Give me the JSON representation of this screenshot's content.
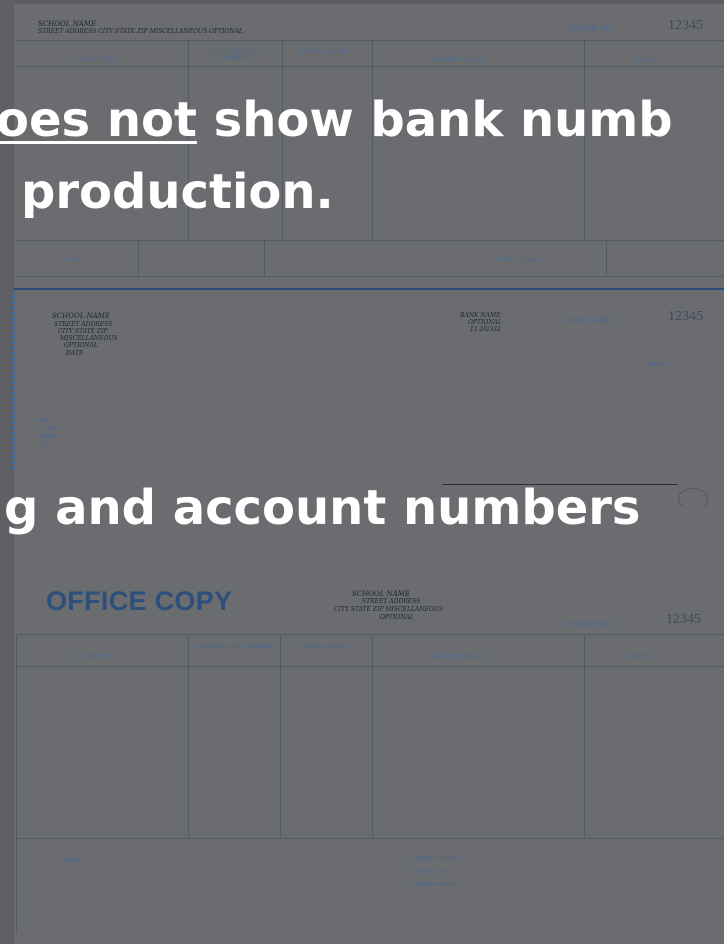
{
  "overlay": {
    "line1_prefix": "oes not",
    "line1_suffix": " show bank numb",
    "line2": "production.",
    "line3": "g and account numbers"
  },
  "stub_top": {
    "school": "SCHOOL NAME",
    "address": "STREET ADDRESS CITY STATE ZIP MISCELLANEOUS OPTIONAL",
    "check_no_label": "CHECK NO.",
    "check_no": "12345",
    "headers": [
      "DESCRIPTION",
      "PURCHASE ORDER NUMBERS",
      "INVOICE NUMBER",
      "ACCOUNT NUMBER",
      "AMOUNT"
    ],
    "date_label": "DATE",
    "check_number_label": "CHECK NUMBER"
  },
  "check": {
    "school": "SCHOOL NAME",
    "address_lines": [
      "STREET ADDRESS",
      "CITY STATE ZIP",
      "MISCELLANEOUS",
      "OPTIONAL"
    ],
    "date_label": "DATE",
    "bank_lines": [
      "BANK NAME",
      "OPTIONAL",
      "11-26/332"
    ],
    "check_no_label": "CHECK NO.",
    "check_no": "12345",
    "amount_label": "AMOUNT",
    "pay_label_lines": [
      "PAY",
      "TO THE",
      "ORDER",
      "OF"
    ]
  },
  "office_copy": {
    "title": "OFFICE COPY",
    "school": "SCHOOL NAME",
    "address_lines": [
      "STREET ADDRESS",
      "CITY STATE ZIP MISCELLANEOUS",
      "OPTIONAL"
    ],
    "check_no_label": "CHECK NO.",
    "check_no": "12345",
    "headers": [
      "DESCRIPTION",
      "PURCHASE ORDER NUMBER",
      "INVOICE NUMBER",
      "ACCOUNT NUMBER",
      "AMOUNT"
    ],
    "payee_label": "PAYEE",
    "footer_labels": [
      "CHECK NUMBER",
      "CHECK DATE",
      "CHECK AMOUNT"
    ]
  }
}
